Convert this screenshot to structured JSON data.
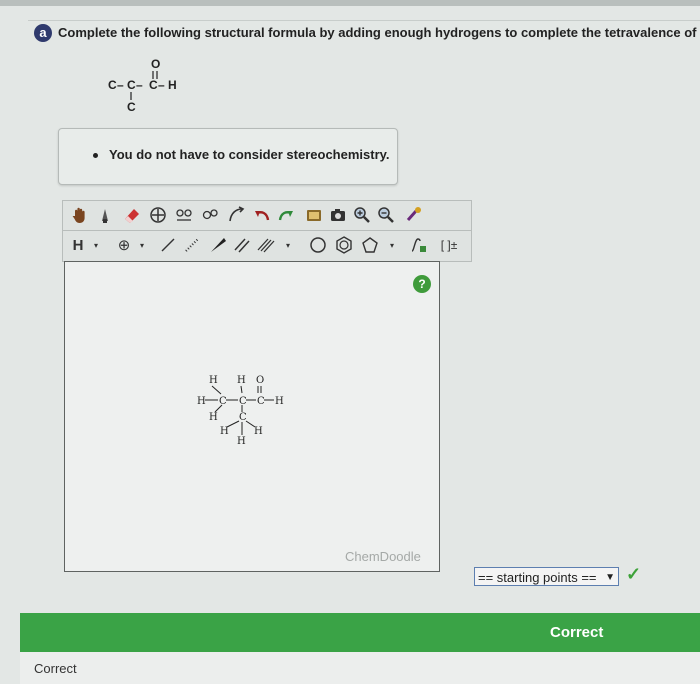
{
  "question": {
    "badge": "a",
    "text": "Complete the following structural formula by adding enough hydrogens to complete the tetravalence of e"
  },
  "given_formula": {
    "o": "O",
    "c1": "C",
    "c2": "C",
    "c3": "C",
    "c4": "C",
    "h": "H",
    "dash": "–"
  },
  "hint": {
    "text": "You do not have to consider stereochemistry."
  },
  "toolbar": {
    "element_label": "H",
    "charge_label": "⊕",
    "ring_caret": "▾",
    "bracket_label": "[ ]±"
  },
  "canvas": {
    "help_label": "?",
    "watermark": "ChemDoodle",
    "molecule": {
      "h_top1": "H",
      "h_top2": "H",
      "o": "O",
      "h_left": "H",
      "c1": "C",
      "c2": "C",
      "c3": "C",
      "h_right": "H",
      "h_lower_left": "H",
      "c4": "C",
      "h_b1": "H",
      "h_b2": "H",
      "h_b3": "H"
    }
  },
  "answer_select": {
    "value": "== starting points =="
  },
  "result": {
    "status": "Correct",
    "footer": "Correct",
    "color": "#3aa346"
  }
}
